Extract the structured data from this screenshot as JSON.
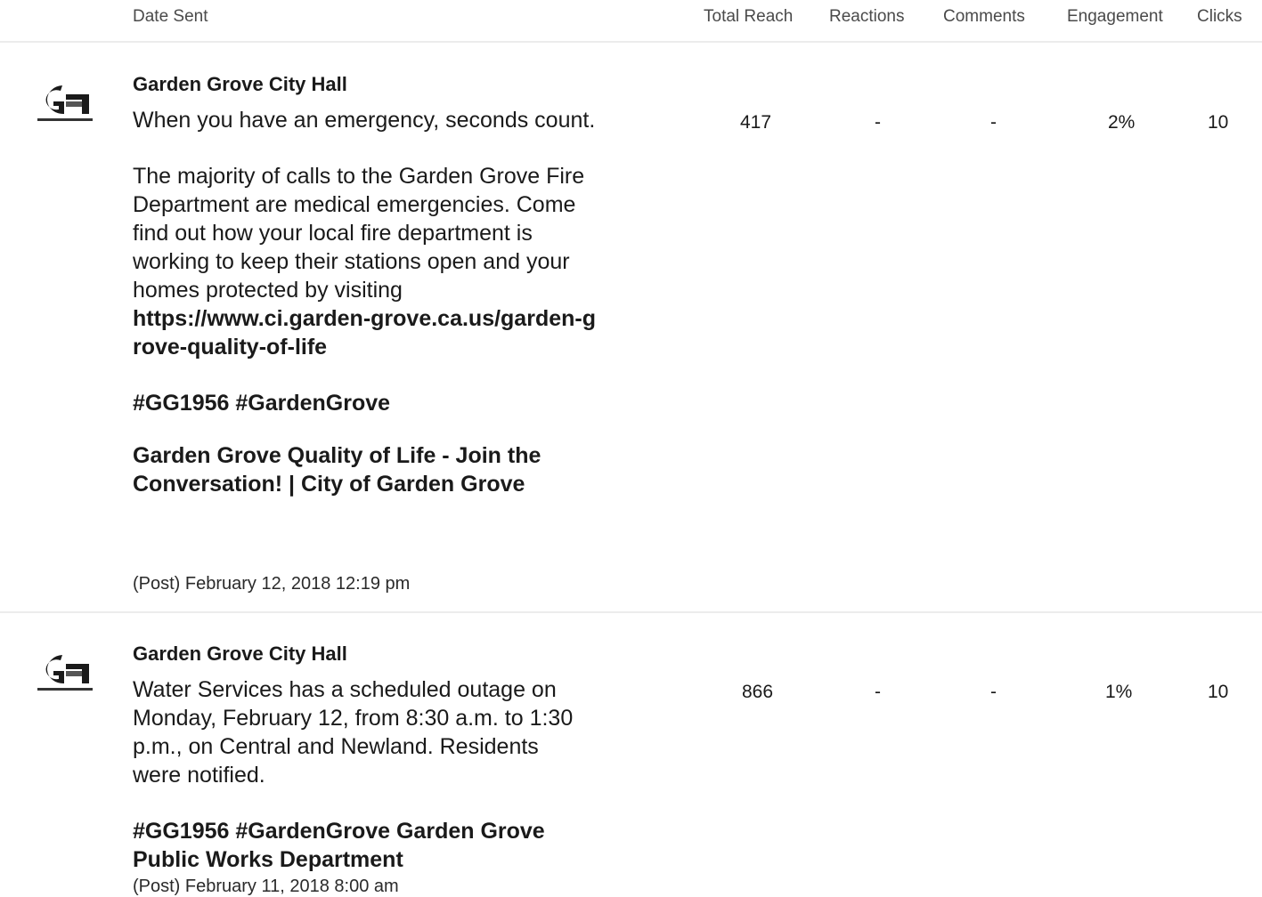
{
  "header": {
    "date_sent": "Date Sent",
    "total_reach": "Total Reach",
    "reactions": "Reactions",
    "comments": "Comments",
    "engagement": "Engagement",
    "clicks": "Clicks"
  },
  "posts": [
    {
      "logo_icon": "garden-grove-logo",
      "author": "Garden Grove City Hall",
      "text_1": "When you have an emergency, seconds count.",
      "text_2": "The majority of calls to the Garden Grove Fire Department are medical emergencies. Come find out how your local fire department is working to keep their stations open and your homes protected by visiting",
      "link": "https://www.ci.garden-grove.ca.us/garden-grove-quality-of-life",
      "hashtags": "#GG1956 #GardenGrove",
      "link_title": "Garden Grove Quality of Life - Join the Conversation! | City of Garden Grove",
      "meta": "(Post) February 12, 2018 12:19 pm",
      "total_reach": "417",
      "reactions": "-",
      "comments": "-",
      "engagement": "2%",
      "clicks": "10"
    },
    {
      "logo_icon": "garden-grove-logo",
      "author": "Garden Grove City Hall",
      "text_1": "Water Services has a scheduled outage on Monday, February 12, from 8:30 a.m. to 1:30 p.m., on Central and Newland. Residents were notified.",
      "hashtags": "#GG1956 #GardenGrove Garden Grove Public Works Department",
      "meta": "(Post) February 11, 2018 8:00 am",
      "total_reach": "866",
      "reactions": "-",
      "comments": "-",
      "engagement": "1%",
      "clicks": "10"
    }
  ]
}
